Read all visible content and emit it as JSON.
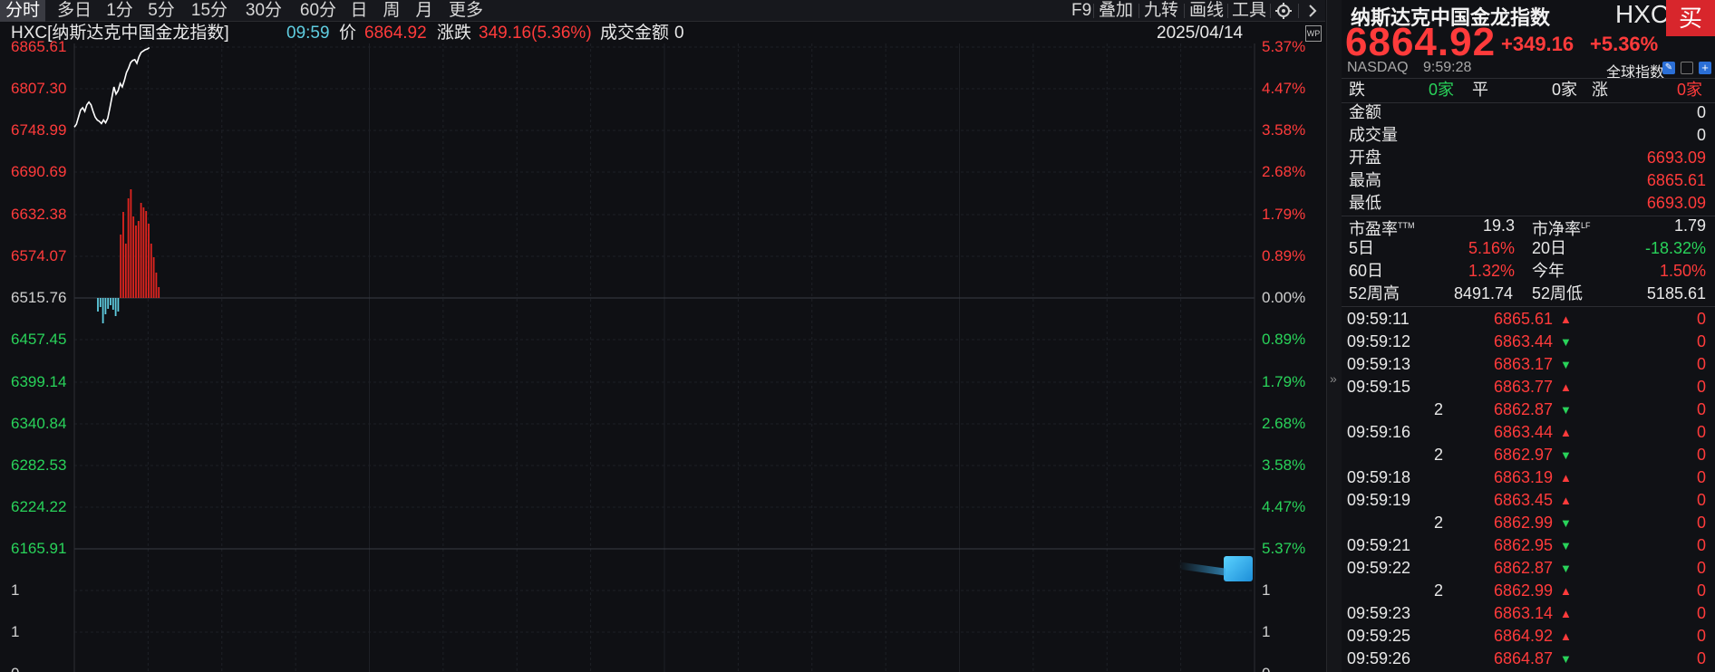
{
  "topbar": {
    "tabs": [
      "分时",
      "多日",
      "1分",
      "5分",
      "15分",
      "30分",
      "60分",
      "日",
      "周",
      "月",
      "更多"
    ],
    "active_tab": "分时",
    "tools": [
      "F9",
      "叠加",
      "九转",
      "画线",
      "工具"
    ],
    "gear_icon": "gear-icon",
    "next_icon": "chevron-right-icon"
  },
  "info": {
    "title": "HXC[纳斯达克中国金龙指数]",
    "time": "09:59",
    "price_label": "价",
    "price": "6864.92",
    "change_label": "涨跌",
    "change": "349.16(5.36%)",
    "amount_label": "成交金额",
    "amount": "0",
    "date": "2025/04/14",
    "wp_badge": "WP"
  },
  "chart": {
    "left_labels": [
      "6865.61",
      "6807.30",
      "6748.99",
      "6690.69",
      "6632.38",
      "6574.07",
      "6515.76",
      "6457.45",
      "6399.14",
      "6340.84",
      "6282.53",
      "6224.22",
      "6165.91",
      "1",
      "1",
      "0"
    ],
    "right_labels": [
      "5.37%",
      "4.47%",
      "3.58%",
      "2.68%",
      "1.79%",
      "0.89%",
      "0.00%",
      "0.89%",
      "1.79%",
      "2.68%",
      "3.58%",
      "4.47%",
      "5.37%",
      "1",
      "1",
      "0"
    ],
    "prev_close": 6515.76,
    "price_max": 6865.61,
    "price_min": 6165.91
  },
  "chart_data": {
    "type": "line",
    "series": [
      {
        "values": [
          6754,
          6758,
          6768,
          6778,
          6781,
          6776,
          6785,
          6789,
          6785,
          6776,
          6768,
          6764,
          6762,
          6759,
          6764,
          6760,
          6766,
          6780,
          6795,
          6810,
          6800,
          6805,
          6815,
          6810,
          6819,
          6830,
          6836,
          6844,
          6847,
          6848,
          6843,
          6852,
          6858,
          6860,
          6862,
          6863,
          6864.92
        ]
      }
    ],
    "ylim": [
      6165.91,
      6865.61
    ],
    "bars": [
      -15,
      -10,
      -28,
      -18,
      -12,
      -8,
      -13,
      -20,
      -15,
      70,
      95,
      60,
      110,
      120,
      90,
      80,
      85,
      105,
      100,
      96,
      82,
      60,
      45,
      28,
      12
    ]
  },
  "panel": {
    "name": "纳斯达克中国金龙指数",
    "code": "HXC",
    "price": "6864.92",
    "change": "+349.16",
    "change_pct": "+5.36%",
    "market": "NASDAQ",
    "time": "9:59:28",
    "buy_label": "买",
    "global_label": "全球指数",
    "stats": {
      "down_label": "跌",
      "down": "0家",
      "flat_label": "平",
      "flat": "0家",
      "up_label": "涨",
      "up": "0家"
    },
    "rows": [
      {
        "label": "金额",
        "value": "0"
      },
      {
        "label": "成交量",
        "value": "0"
      },
      {
        "label": "开盘",
        "value": "6693.09"
      },
      {
        "label": "最高",
        "value": "6865.61"
      },
      {
        "label": "最低",
        "value": "6693.09"
      }
    ],
    "pe_label": "市盈率",
    "pe_sup": "TTM",
    "pe": "19.3",
    "pb_label": "市净率",
    "pb_sup": "LF",
    "pb": "1.79",
    "d5_label": "5日",
    "d5": "5.16%",
    "d20_label": "20日",
    "d20": "-18.32%",
    "d60_label": "60日",
    "d60": "1.32%",
    "ytd_label": "今年",
    "ytd": "1.50%",
    "hi52_label": "52周高",
    "hi52": "8491.74",
    "lo52_label": "52周低",
    "lo52": "5185.61",
    "ticks": [
      {
        "time": "09:59:11",
        "price": "6865.61",
        "dir": "up",
        "vol": "0"
      },
      {
        "time": "09:59:12",
        "price": "6863.44",
        "dir": "down",
        "vol": "0"
      },
      {
        "time": "09:59:13",
        "price": "6863.17",
        "dir": "down",
        "vol": "0"
      },
      {
        "time": "09:59:15",
        "price": "6863.77",
        "dir": "up",
        "vol": "0"
      },
      {
        "time": "2",
        "price": "6862.87",
        "dir": "down",
        "vol": "0"
      },
      {
        "time": "09:59:16",
        "price": "6863.44",
        "dir": "up",
        "vol": "0"
      },
      {
        "time": "2",
        "price": "6862.97",
        "dir": "down",
        "vol": "0"
      },
      {
        "time": "09:59:18",
        "price": "6863.19",
        "dir": "up",
        "vol": "0"
      },
      {
        "time": "09:59:19",
        "price": "6863.45",
        "dir": "up",
        "vol": "0"
      },
      {
        "time": "2",
        "price": "6862.99",
        "dir": "down",
        "vol": "0"
      },
      {
        "time": "09:59:21",
        "price": "6862.95",
        "dir": "down",
        "vol": "0"
      },
      {
        "time": "09:59:22",
        "price": "6862.87",
        "dir": "down",
        "vol": "0"
      },
      {
        "time": "2",
        "price": "6862.99",
        "dir": "up",
        "vol": "0"
      },
      {
        "time": "09:59:23",
        "price": "6863.14",
        "dir": "up",
        "vol": "0"
      },
      {
        "time": "09:59:25",
        "price": "6864.92",
        "dir": "up",
        "vol": "0"
      },
      {
        "time": "09:59:26",
        "price": "6864.87",
        "dir": "down",
        "vol": "0"
      }
    ]
  }
}
